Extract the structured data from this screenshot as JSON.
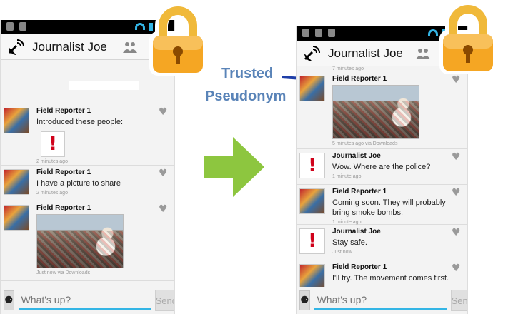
{
  "left": {
    "title": "Journalist Joe",
    "messages": [
      {
        "sender": "Field Reporter 1",
        "text": "Introduced these people:",
        "time": "2 minutes ago"
      },
      {
        "sender": "Field Reporter 1",
        "text": "I have a picture to share",
        "time": "2 minutes ago"
      },
      {
        "sender": "Field Reporter 1",
        "time": "Just now via Downloads"
      }
    ],
    "composer": {
      "placeholder": "What's up?",
      "send": "Send"
    }
  },
  "right": {
    "title": "Journalist Joe",
    "top_time": "7 minutes ago",
    "messages": [
      {
        "sender": "Field Reporter 1",
        "time": "5 minutes ago via Downloads"
      },
      {
        "sender": "Journalist Joe",
        "text": "Wow. Where are the police?",
        "time": "1 minute ago"
      },
      {
        "sender": "Field Reporter 1",
        "text": "Coming soon. They will probably bring smoke bombs.",
        "time": "1 minute ago"
      },
      {
        "sender": "Journalist Joe",
        "text": "Stay safe.",
        "time": "Just now"
      },
      {
        "sender": "Field Reporter 1",
        "text": "I'll try. The movement comes first."
      }
    ],
    "composer": {
      "placeholder": "What's up?",
      "send": "Send"
    }
  },
  "annotation": {
    "line1": "Trusted",
    "line2": "Pseudonym"
  },
  "colors": {
    "accent": "#33b5e5",
    "arrow": "#8dc63f",
    "annotation": "#5a84b8",
    "lock": "#f5a623"
  }
}
